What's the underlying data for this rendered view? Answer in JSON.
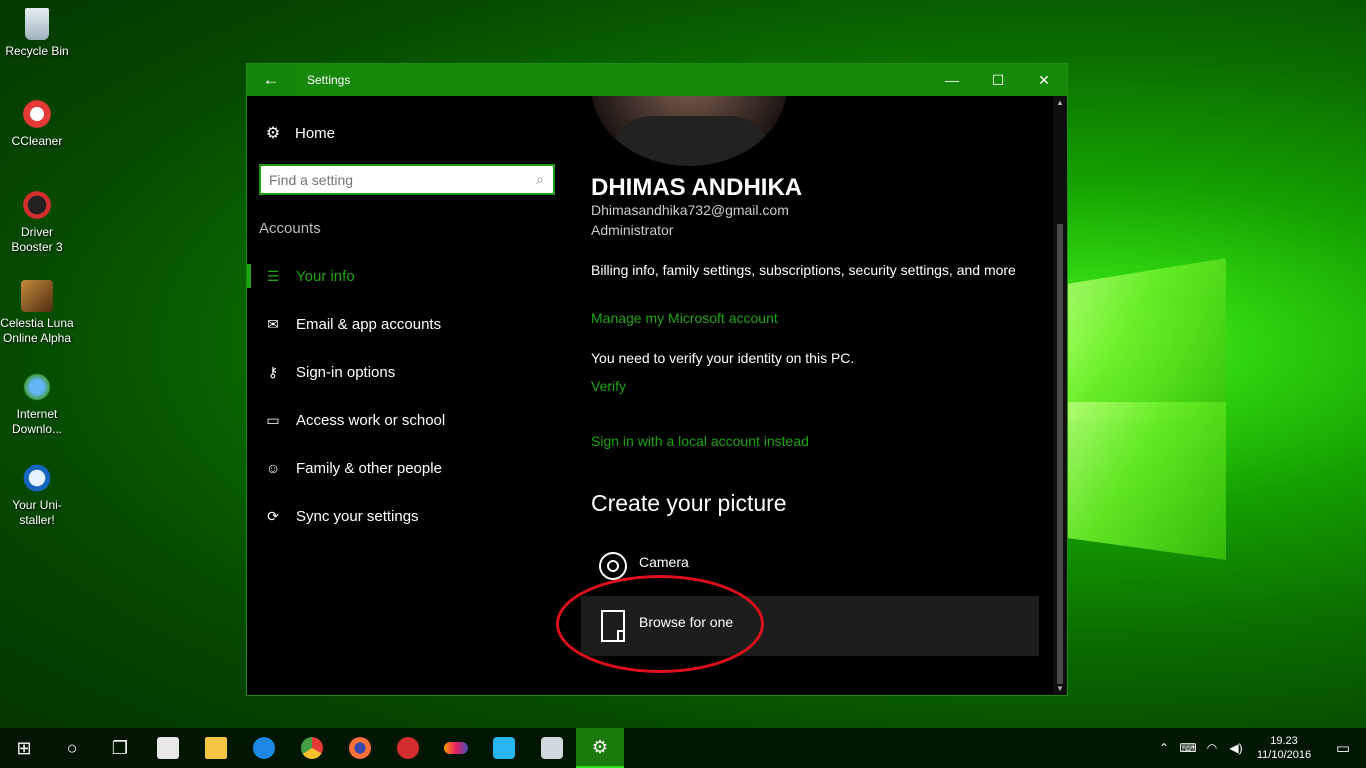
{
  "desktop": {
    "icons": [
      {
        "label": "Recycle Bin",
        "icon": "recycle-bin-icon"
      },
      {
        "label": "CCleaner",
        "icon": "ccleaner-icon"
      },
      {
        "label": "Driver Booster 3",
        "icon": "driver-booster-icon"
      },
      {
        "label": "Celestia Luna Online Alpha",
        "icon": "celestia-icon"
      },
      {
        "label": "Internet Downlo...",
        "icon": "internet-download-manager-icon"
      },
      {
        "label": "Your Uni-staller!",
        "icon": "your-uninstaller-icon"
      }
    ]
  },
  "window": {
    "title": "Settings",
    "back_icon": "←",
    "minimize_icon": "—",
    "maximize_icon": "☐",
    "close_icon": "✕"
  },
  "nav": {
    "home_label": "Home",
    "search_placeholder": "Find a setting",
    "section": "Accounts",
    "items": [
      {
        "label": "Your info",
        "icon": "person-card-icon",
        "glyph": "☰",
        "active": true
      },
      {
        "label": "Email & app accounts",
        "icon": "mail-icon",
        "glyph": "✉",
        "active": false
      },
      {
        "label": "Sign-in options",
        "icon": "key-icon",
        "glyph": "⚷",
        "active": false
      },
      {
        "label": "Access work or school",
        "icon": "briefcase-icon",
        "glyph": "▭",
        "active": false
      },
      {
        "label": "Family & other people",
        "icon": "person-add-icon",
        "glyph": "☺",
        "active": false
      },
      {
        "label": "Sync your settings",
        "icon": "sync-icon",
        "glyph": "⟳",
        "active": false
      }
    ]
  },
  "profile": {
    "name": "DHIMAS ANDHIKA",
    "email": "Dhimasandhika732@gmail.com",
    "role": "Administrator",
    "billing_text": "Billing info, family settings, subscriptions, security settings, and more",
    "manage_link": "Manage my Microsoft account",
    "verify_msg": "You need to verify your identity on this PC.",
    "verify_link": "Verify",
    "local_link": "Sign in with a local account instead"
  },
  "create_picture": {
    "heading": "Create your picture",
    "options": [
      {
        "label": "Camera",
        "icon": "camera-icon"
      },
      {
        "label": "Browse for one",
        "icon": "browse-file-icon"
      }
    ]
  },
  "taskbar": {
    "items": [
      {
        "name": "start-button",
        "glyph": "⊞"
      },
      {
        "name": "cortana-search-button",
        "glyph": "○"
      },
      {
        "name": "task-view-button",
        "glyph": "❐"
      },
      {
        "name": "store-icon",
        "color": "#e8e8e8"
      },
      {
        "name": "file-explorer-icon",
        "color": "#f4c542"
      },
      {
        "name": "edge-icon",
        "color": "#1e88e5"
      },
      {
        "name": "chrome-icon",
        "color": "#e53935"
      },
      {
        "name": "firefox-icon",
        "color": "#ff7139"
      },
      {
        "name": "app-red-icon",
        "color": "#d32f2f"
      },
      {
        "name": "app-infinity-icon",
        "color": "#ff9800"
      },
      {
        "name": "app-e-icon",
        "color": "#29b6f6"
      },
      {
        "name": "app-paint-icon",
        "color": "#cfd8dc"
      },
      {
        "name": "settings-taskbar-icon",
        "glyph": "⚙",
        "active": true
      }
    ],
    "tray": {
      "chevron": "⌃",
      "input": "⌨",
      "wifi": "◠",
      "volume": "◀)",
      "time": "19.23",
      "date": "11/10/2016",
      "notifications": "▭"
    }
  }
}
